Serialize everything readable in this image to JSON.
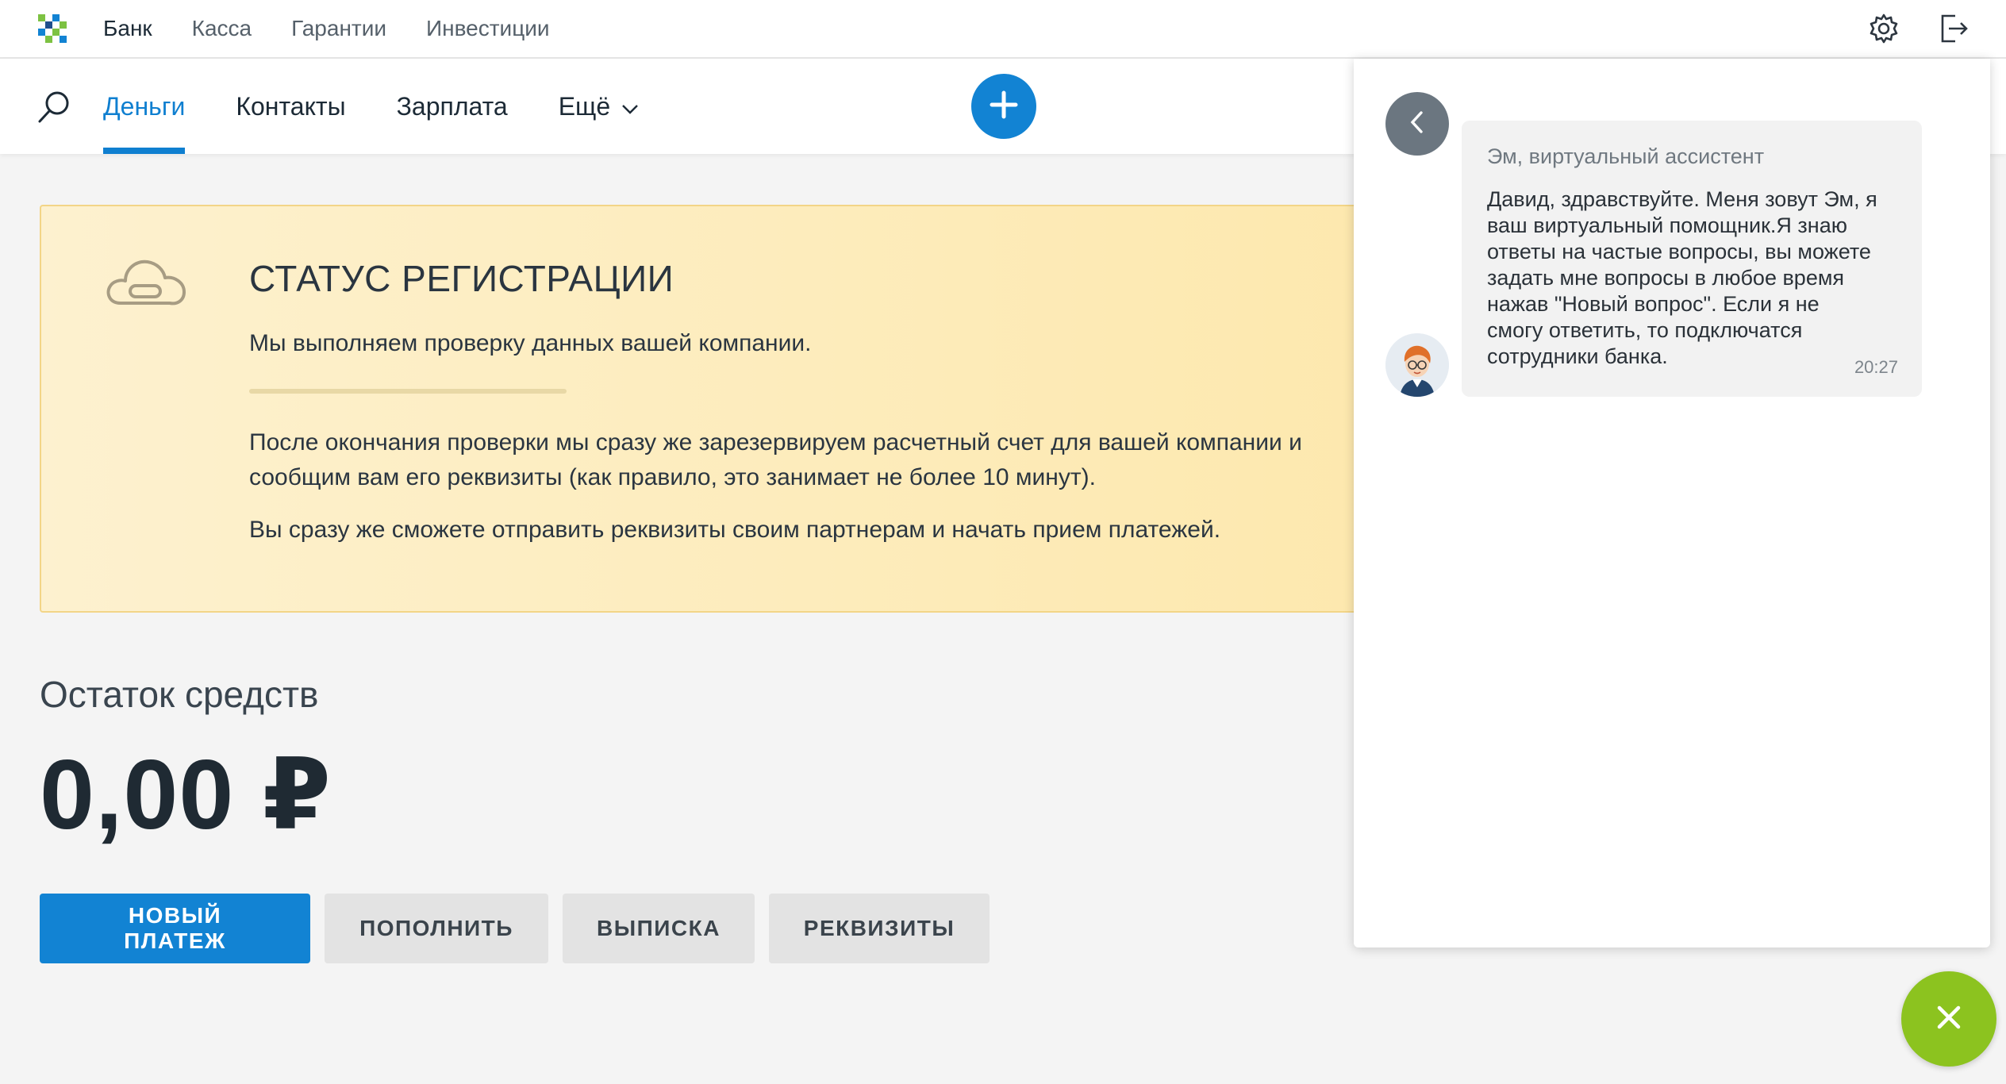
{
  "topnav": {
    "items": [
      {
        "label": "Банк"
      },
      {
        "label": "Касса"
      },
      {
        "label": "Гарантии"
      },
      {
        "label": "Инвестиции"
      }
    ],
    "icons": [
      "gear-icon",
      "logout-icon"
    ]
  },
  "subnav": {
    "tabs": [
      {
        "label": "Деньги"
      },
      {
        "label": "Контакты"
      },
      {
        "label": "Зарплата"
      },
      {
        "label": "Ещё"
      }
    ],
    "icons": [
      "search-icon",
      "plus-icon",
      "chevron-down-icon"
    ]
  },
  "status": {
    "title": "СТАТУС РЕГИСТРАЦИИ",
    "subtitle": "Мы выполняем проверку данных вашей компании.",
    "paragraph1_line1": "После окончания проверки мы сразу же зарезервируем расчетный счет для вашей компании и",
    "paragraph1_line2": "сообщим вам его реквизиты (как правило, это занимает не более 10 минут).",
    "paragraph2": "Вы сразу же сможете отправить реквизиты своим партнерам и начать прием платежей.",
    "icon": "cloud-icon"
  },
  "balance": {
    "title": "Остаток средств",
    "amount": "0,00 ₽"
  },
  "actions": {
    "new_payment": "НОВЫЙ ПЛАТЕЖ",
    "top_up": "ПОПОЛНИТЬ",
    "statement": "ВЫПИСКА",
    "requisites": "РЕКВИЗИТЫ"
  },
  "chat": {
    "author": "Эм, виртуальный ассистент",
    "message_lines": [
      "Давид, здравствуйте. Меня зовут Эм, я",
      "ваш виртуальный помощник.Я знаю",
      "ответы на частые вопросы, вы можете",
      "задать мне вопросы в любое время",
      "нажав \"Новый вопрос\". Если я не",
      "смогу ответить, то подключатся",
      "сотрудники банка."
    ],
    "time": "20:27",
    "icons": [
      "chevron-left-icon",
      "assistant-avatar",
      "close-icon"
    ]
  },
  "colors": {
    "accent": "#1283d3",
    "banner_bg": "#fde8ad",
    "fab": "#8cc31f"
  }
}
